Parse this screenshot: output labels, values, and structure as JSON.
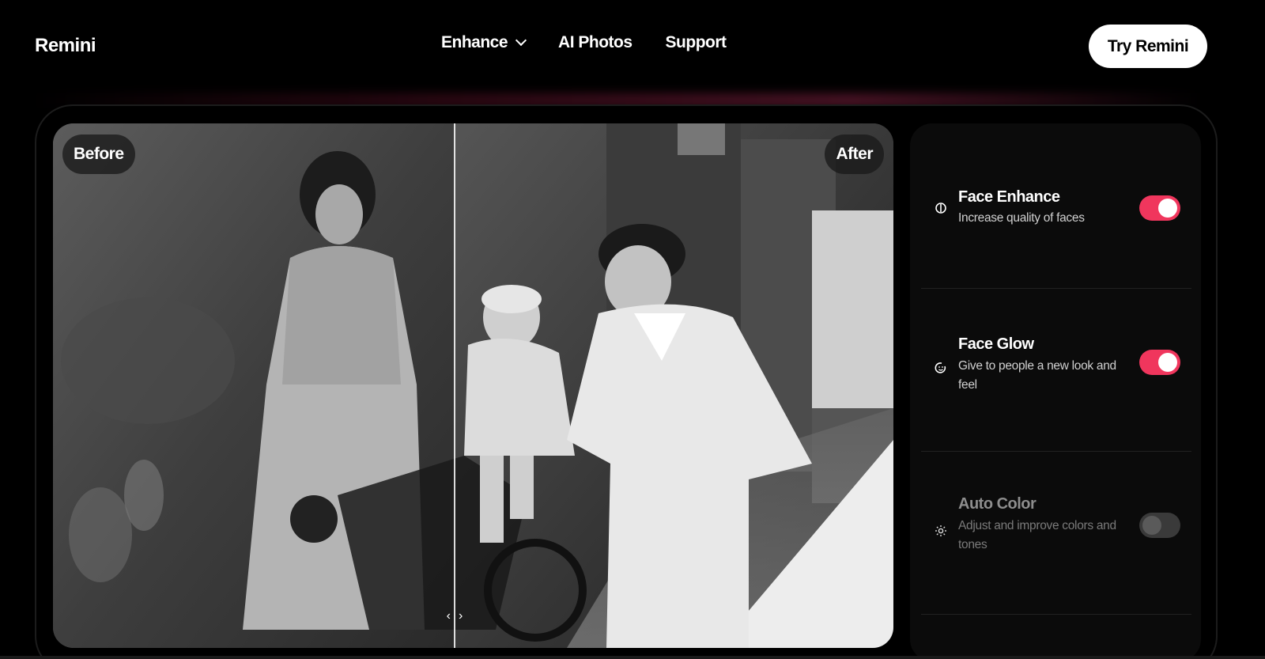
{
  "header": {
    "logo": "Remini",
    "nav": [
      {
        "label": "Enhance",
        "has_dropdown": true
      },
      {
        "label": "AI Photos",
        "has_dropdown": false
      },
      {
        "label": "Support",
        "has_dropdown": false
      }
    ],
    "cta_label": "Try Remini"
  },
  "compare": {
    "before_label": "Before",
    "after_label": "After",
    "slider_left_glyph": "‹",
    "slider_right_glyph": "›"
  },
  "panel": {
    "options": [
      {
        "title": "Face Enhance",
        "description": "Increase quality of faces",
        "enabled": true,
        "icon": "face-enhance-icon"
      },
      {
        "title": "Face Glow",
        "description": "Give to people a new look and feel",
        "enabled": true,
        "icon": "face-glow-icon"
      },
      {
        "title": "Auto Color",
        "description": "Adjust and improve colors and tones",
        "enabled": false,
        "icon": "sun-icon"
      }
    ]
  },
  "colors": {
    "toggle_on": "#f0365d",
    "toggle_off": "#3a3a3a",
    "background": "#000000",
    "panel": "#0b0b0b"
  }
}
